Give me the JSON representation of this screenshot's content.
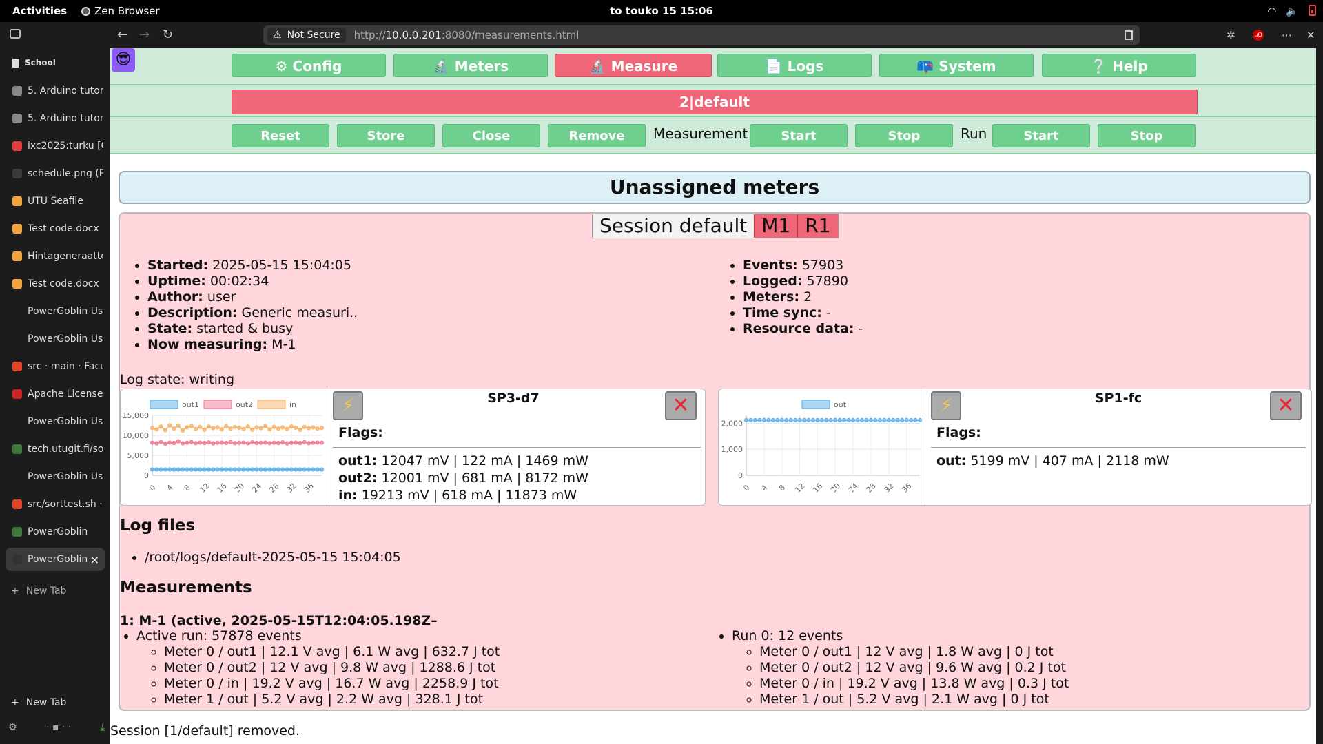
{
  "topbar": {
    "activities": "Activities",
    "app_name": "Zen Browser",
    "clock": "to touko 15  15:06"
  },
  "sidebar": {
    "workspace": "School",
    "tabs": [
      {
        "title": "5. Arduino tutor",
        "color": "#888888",
        "icon": "doc-icon"
      },
      {
        "title": "5. Arduino tutor",
        "color": "#888888",
        "icon": "doc-icon"
      },
      {
        "title": "ixc2025:turku [C",
        "color": "#e33d3d",
        "icon": "wiki-icon"
      },
      {
        "title": "schedule.png (P",
        "color": "#3a3a3a",
        "icon": "image-icon"
      },
      {
        "title": "UTU Seafile",
        "color": "#f2a33a",
        "icon": "seafile-icon"
      },
      {
        "title": "Test code.docx",
        "color": "#f2a33a",
        "icon": "seafile-icon"
      },
      {
        "title": "Hintageneraattc",
        "color": "#f2a33a",
        "icon": "seafile-icon"
      },
      {
        "title": "Test code.docx",
        "color": "#f2a33a",
        "icon": "seafile-icon"
      },
      {
        "title": "PowerGoblin Us",
        "color": "#1c1c1c",
        "icon": "blank-icon"
      },
      {
        "title": "PowerGoblin Us",
        "color": "#1c1c1c",
        "icon": "blank-icon"
      },
      {
        "title": "src · main · Facu",
        "color": "#e24329",
        "icon": "gitlab-icon"
      },
      {
        "title": "Apache License,",
        "color": "#c22",
        "icon": "feather-icon"
      },
      {
        "title": "PowerGoblin Us",
        "color": "#1c1c1c",
        "icon": "blank-icon"
      },
      {
        "title": "tech.utugit.fi/so",
        "color": "#3c7a3c",
        "icon": "site-icon"
      },
      {
        "title": "PowerGoblin Us",
        "color": "#1c1c1c",
        "icon": "blank-icon"
      },
      {
        "title": "src/sorttest.sh ·",
        "color": "#e24329",
        "icon": "gitlab-icon"
      },
      {
        "title": "PowerGoblin",
        "color": "#3c7a3c",
        "icon": "site-icon"
      },
      {
        "title": "PowerGoblin",
        "color": "#333333",
        "icon": "goblin-icon",
        "active": true
      }
    ],
    "new_tab_label": "New Tab",
    "new_tab_bottom_label": "New Tab"
  },
  "browser": {
    "not_secure": "Not Secure",
    "url_prefix": "http://",
    "url_host": "10.0.0.201",
    "url_rest": ":8080/measurements.html"
  },
  "nav": {
    "tabs": [
      {
        "label": "⚙ Config"
      },
      {
        "label": "🔬 Meters"
      },
      {
        "label": "🔬 Measure",
        "active": true
      },
      {
        "label": "📄 Logs"
      },
      {
        "label": "📪 System"
      },
      {
        "label": "❔ Help"
      }
    ],
    "avatar": "😎",
    "session_bar": "2|default",
    "actions": {
      "reset": "Reset",
      "store": "Store",
      "close": "Close",
      "remove": "Remove",
      "measurement_label": "Measurement",
      "m_start": "Start",
      "m_stop": "Stop",
      "run_label": "Run",
      "r_start": "Start",
      "r_stop": "Stop"
    }
  },
  "unassigned_title": "Unassigned meters",
  "session": {
    "name": "Session default",
    "m_badge": "M1",
    "r_badge": "R1",
    "info_left": [
      {
        "k": "Started:",
        "v": "2025-05-15 15:04:05"
      },
      {
        "k": "Uptime:",
        "v": "00:02:34"
      },
      {
        "k": "Author:",
        "v": "user"
      },
      {
        "k": "Description:",
        "v": "Generic measuri.."
      },
      {
        "k": "State:",
        "v": "started & busy"
      },
      {
        "k": "Now measuring:",
        "v": "M-1"
      }
    ],
    "info_right": [
      {
        "k": "Events:",
        "v": "57903"
      },
      {
        "k": "Logged:",
        "v": "57890"
      },
      {
        "k": "Meters:",
        "v": "2"
      },
      {
        "k": "Time sync:",
        "v": "-"
      },
      {
        "k": "Resource data:",
        "v": "-"
      }
    ],
    "log_state": "Log state: writing"
  },
  "meters": [
    {
      "name": "SP3-d7",
      "flags_label": "Flags:",
      "values": [
        {
          "k": "out1:",
          "v": "12047 mV | 122 mA | 1469 mW"
        },
        {
          "k": "out2:",
          "v": "12001 mV | 681 mA | 8172 mW"
        },
        {
          "k": "in:",
          "v": "19213 mV | 618 mA | 11873 mW"
        }
      ]
    },
    {
      "name": "SP1-fc",
      "flags_label": "Flags:",
      "values": [
        {
          "k": "out:",
          "v": "5199 mV | 407 mA | 2118 mW"
        }
      ]
    }
  ],
  "chart_data": [
    {
      "type": "line",
      "x": [
        0,
        1,
        2,
        3,
        4,
        5,
        6,
        7,
        8,
        9,
        10,
        11,
        12,
        13,
        14,
        15,
        16,
        17,
        18,
        19,
        20,
        21,
        22,
        23,
        24,
        25,
        26,
        27,
        28,
        29,
        30,
        31,
        32,
        33,
        34,
        35,
        36,
        37,
        38,
        39
      ],
      "xticks": [
        "0",
        "4",
        "8",
        "12",
        "16",
        "20",
        "24",
        "28",
        "32",
        "36"
      ],
      "yticks": [
        "0",
        "5,000",
        "10,000",
        "15,000"
      ],
      "ylim": [
        0,
        15000
      ],
      "series": [
        {
          "name": "out1",
          "color": "#5aaee8",
          "values": [
            1469,
            1480,
            1460,
            1475,
            1470,
            1465,
            1478,
            1472,
            1468,
            1460,
            1475,
            1470,
            1469,
            1480,
            1462,
            1470,
            1474,
            1466,
            1471,
            1469,
            1476,
            1463,
            1470,
            1472,
            1468,
            1475,
            1466,
            1470,
            1469,
            1473,
            1467,
            1470,
            1471,
            1468,
            1474,
            1466,
            1470,
            1469,
            1472,
            1468
          ]
        },
        {
          "name": "out2",
          "color": "#f27792",
          "values": [
            8172,
            8000,
            8350,
            7900,
            8200,
            8100,
            8500,
            8000,
            8150,
            8300,
            8050,
            8200,
            8100,
            8250,
            8000,
            8150,
            8200,
            8100,
            8300,
            8050,
            8150,
            8200,
            8000,
            8250,
            8100,
            8150,
            8200,
            8050,
            8150,
            8100,
            8250,
            8000,
            8150,
            8200,
            8100,
            8300,
            8050,
            8150,
            8200,
            8172
          ]
        },
        {
          "name": "in",
          "color": "#f7b267",
          "values": [
            11873,
            11500,
            12200,
            11300,
            12500,
            11700,
            12400,
            11200,
            12000,
            12300,
            11600,
            12100,
            11400,
            12200,
            11800,
            12000,
            11500,
            12300,
            11700,
            12100,
            11900,
            11600,
            12200,
            11400,
            12000,
            11800,
            12300,
            11500,
            12100,
            11700,
            12000,
            11600,
            12200,
            11900,
            11400,
            12100,
            11800,
            12000,
            11700,
            11873
          ]
        }
      ]
    },
    {
      "type": "line",
      "x": [
        0,
        1,
        2,
        3,
        4,
        5,
        6,
        7,
        8,
        9,
        10,
        11,
        12,
        13,
        14,
        15,
        16,
        17,
        18,
        19,
        20,
        21,
        22,
        23,
        24,
        25,
        26,
        27,
        28,
        29,
        30,
        31,
        32,
        33,
        34,
        35,
        36,
        37,
        38,
        39
      ],
      "xticks": [
        "0",
        "4",
        "8",
        "12",
        "16",
        "20",
        "24",
        "28",
        "32",
        "36"
      ],
      "yticks": [
        "0",
        "1,000",
        "2,000"
      ],
      "ylim": [
        0,
        2300
      ],
      "series": [
        {
          "name": "out",
          "color": "#5aaee8",
          "values": [
            2118,
            2120,
            2115,
            2119,
            2118,
            2121,
            2117,
            2118,
            2120,
            2116,
            2118,
            2119,
            2117,
            2118,
            2120,
            2118,
            2116,
            2119,
            2118,
            2117,
            2120,
            2118,
            2119,
            2116,
            2118,
            2120,
            2117,
            2118,
            2119,
            2118,
            2116,
            2120,
            2118,
            2117,
            2119,
            2118,
            2120,
            2116,
            2118,
            2118
          ]
        }
      ]
    }
  ],
  "log_files": {
    "title": "Log files",
    "files": [
      "/root/logs/default-2025-05-15 15:04:05"
    ]
  },
  "measurements": {
    "title": "Measurements",
    "heading": "1: M-1 (active, 2025-05-15T12:04:05.198Z–",
    "active_run": "Active run: 57878 events",
    "active_rows": [
      "Meter 0 / out1 | 12.1 V avg | 6.1 W avg | 632.7 J tot",
      "Meter 0 / out2 | 12 V avg | 9.8 W avg | 1288.6 J tot",
      "Meter 0 / in | 19.2 V avg | 16.7 W avg | 2258.9 J tot",
      "Meter 1 / out | 5.2 V avg | 2.2 W avg | 328.1 J tot"
    ],
    "run0": "Run 0: 12 events",
    "run0_rows": [
      "Meter 0 / out1 | 12 V avg | 1.8 W avg | 0 J tot",
      "Meter 0 / out2 | 12 V avg | 9.6 W avg | 0.2 J tot",
      "Meter 0 / in | 19.2 V avg | 13.8 W avg | 0.3 J tot",
      "Meter 1 / out | 5.2 V avg | 2.1 W avg | 0 J tot"
    ]
  },
  "status_message": "Session [1/default] removed."
}
